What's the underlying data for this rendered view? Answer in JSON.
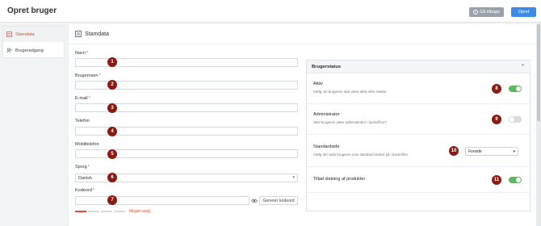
{
  "header": {
    "title": "Opret bruger",
    "back_label": "Gå tilbage",
    "create_label": "Opret"
  },
  "sidebar": {
    "items": [
      {
        "label": "Stamdata",
        "icon": "list-icon",
        "active": true
      },
      {
        "label": "Brugeradgang",
        "icon": "users-icon",
        "active": false
      }
    ]
  },
  "section": {
    "title": "Stamdata",
    "icon": "list-icon"
  },
  "fields": [
    {
      "label": "Navn",
      "required": "*",
      "value": "",
      "marker": "1"
    },
    {
      "label": "Brugernavn",
      "required": "*",
      "value": "",
      "marker": "2"
    },
    {
      "label": "E-mail",
      "required": "*",
      "value": "",
      "marker": "3"
    },
    {
      "label": "Telefon",
      "required": "",
      "value": "",
      "marker": "4"
    },
    {
      "label": "Mobiltelefon",
      "required": "",
      "value": "",
      "marker": "5"
    },
    {
      "label": "Sprog",
      "required": "*",
      "value": "Danish",
      "marker": "6"
    },
    {
      "label": "Kodeord",
      "required": "*",
      "value": "",
      "marker": "7"
    }
  ],
  "password": {
    "generate_label": "Generer kodeord",
    "strength_text": "Meget svag"
  },
  "status_panel": {
    "title": "Brugerstatus",
    "rows": [
      {
        "title": "Aktiv",
        "desc": "Vælg om brugeren skal være aktiv eller inaktiv",
        "toggle": "on",
        "marker": "8"
      },
      {
        "title": "Administrator",
        "desc": "Skal brugeren være administrator i backoffice?",
        "toggle": "off",
        "marker": "9"
      },
      {
        "title": "Standardside",
        "desc": "Vælg den side brugeren som standard starter på i backoffice",
        "select_value": "Forside",
        "marker": "10"
      },
      {
        "title": "Tillad sletning af produkter",
        "desc": "",
        "toggle": "on",
        "marker": "11"
      }
    ]
  },
  "colors": {
    "accent": "#3b8ae8",
    "active_nav": "#e8462a",
    "marker": "#8b1a12",
    "toggle_on": "#5cb85c"
  }
}
